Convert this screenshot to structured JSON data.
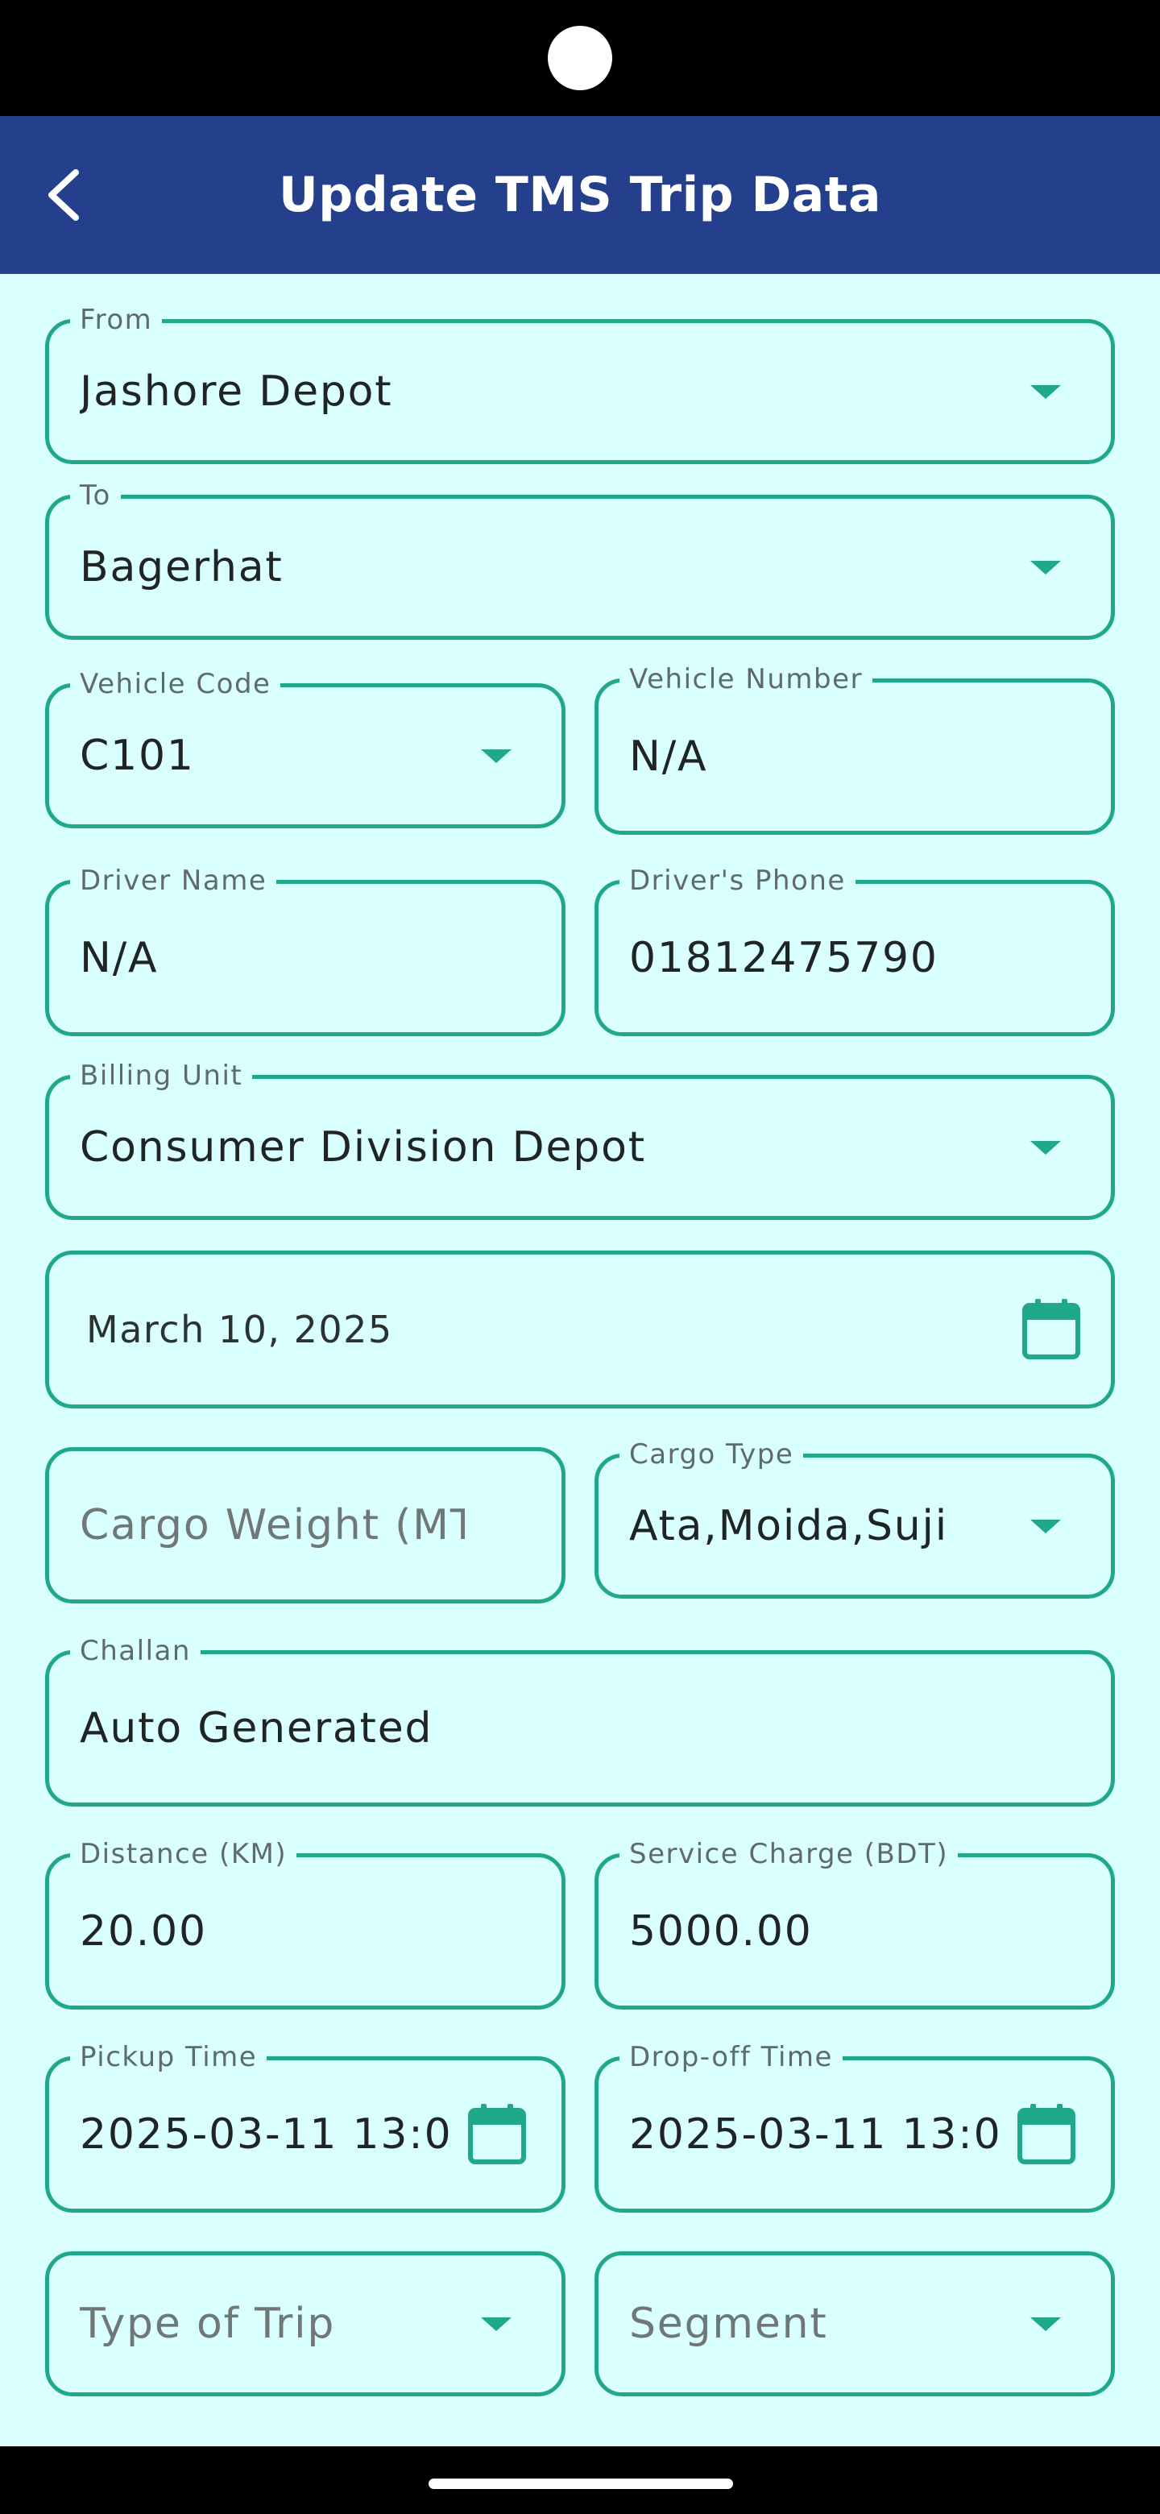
{
  "app_bar": {
    "title": "Update TMS Trip Data",
    "back_icon": "chevron-left-icon"
  },
  "colors": {
    "app_bar": "#243f8c",
    "background": "#daffff",
    "accent": "#1fa88a"
  },
  "form": {
    "from": {
      "label": "From",
      "value": "Jashore Depot"
    },
    "to": {
      "label": "To",
      "value": "Bagerhat"
    },
    "vehicle_code": {
      "label": "Vehicle Code",
      "value": "C101"
    },
    "vehicle_number": {
      "label": "Vehicle Number",
      "value": "N/A"
    },
    "driver_name": {
      "label": "Driver Name",
      "value": "N/A"
    },
    "driver_phone": {
      "label": "Driver's Phone",
      "value": "01812475790"
    },
    "billing_unit": {
      "label": "Billing Unit",
      "value": "Consumer Division  Depot"
    },
    "date": {
      "value": "March 10, 2025",
      "icon": "calendar-icon"
    },
    "cargo_weight": {
      "placeholder": "Cargo Weight (MT)"
    },
    "cargo_type": {
      "label": "Cargo Type",
      "value": "Ata,Moida,Suji"
    },
    "challan": {
      "label": "Challan",
      "value": "Auto Generated"
    },
    "distance": {
      "label": "Distance (KM)",
      "value": "20.00"
    },
    "service_charge": {
      "label": "Service Charge (BDT)",
      "value": "5000.00"
    },
    "pickup_time": {
      "label": "Pickup Time",
      "value": "2025-03-11 13:0",
      "icon": "calendar-icon"
    },
    "dropoff_time": {
      "label": "Drop-off Time",
      "value": "2025-03-11 13:0",
      "icon": "calendar-icon"
    },
    "type_of_trip": {
      "placeholder": "Type of Trip"
    },
    "segment": {
      "placeholder": "Segment"
    }
  }
}
